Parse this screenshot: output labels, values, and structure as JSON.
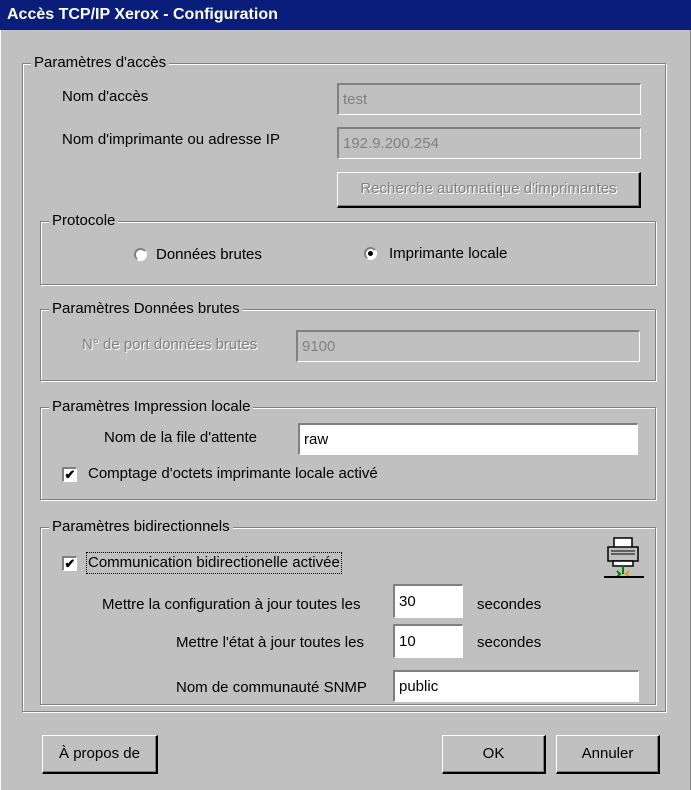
{
  "window": {
    "title": "Accès TCP/IP Xerox - Configuration"
  },
  "access": {
    "group_label": "Paramètres d'accès",
    "name_label": "Nom d'accès",
    "name_value": "test",
    "printer_label": "Nom d'imprimante ou adresse IP",
    "printer_value": "192.9.200.254",
    "search_button": "Recherche automatique d'imprimantes"
  },
  "protocol": {
    "group_label": "Protocole",
    "options": [
      "Données brutes",
      "Imprimante locale"
    ],
    "selected": "Imprimante locale"
  },
  "raw": {
    "group_label": "Paramètres Données brutes",
    "port_label": "N° de port données brutes",
    "port_value": "9100"
  },
  "local": {
    "group_label": "Paramètres Impression locale",
    "queue_label": "Nom de la file d'attente",
    "queue_value": "raw",
    "bytecount_label": "Comptage d'octets imprimante locale activé",
    "bytecount_checked": true
  },
  "bidi": {
    "group_label": "Paramètres bidirectionnels",
    "enabled_label": "Communication bidirectionelle activée",
    "enabled_checked": true,
    "config_label": "Mettre la configuration à jour toutes les",
    "config_value": "30",
    "config_unit": "secondes",
    "state_label": "Mettre l'état à jour toutes les",
    "state_value": "10",
    "state_unit": "secondes",
    "snmp_label": "Nom de communauté SNMP",
    "snmp_value": "public",
    "icon": "printer-network-icon"
  },
  "buttons": {
    "about": "À propos de",
    "ok": "OK",
    "cancel": "Annuler"
  }
}
